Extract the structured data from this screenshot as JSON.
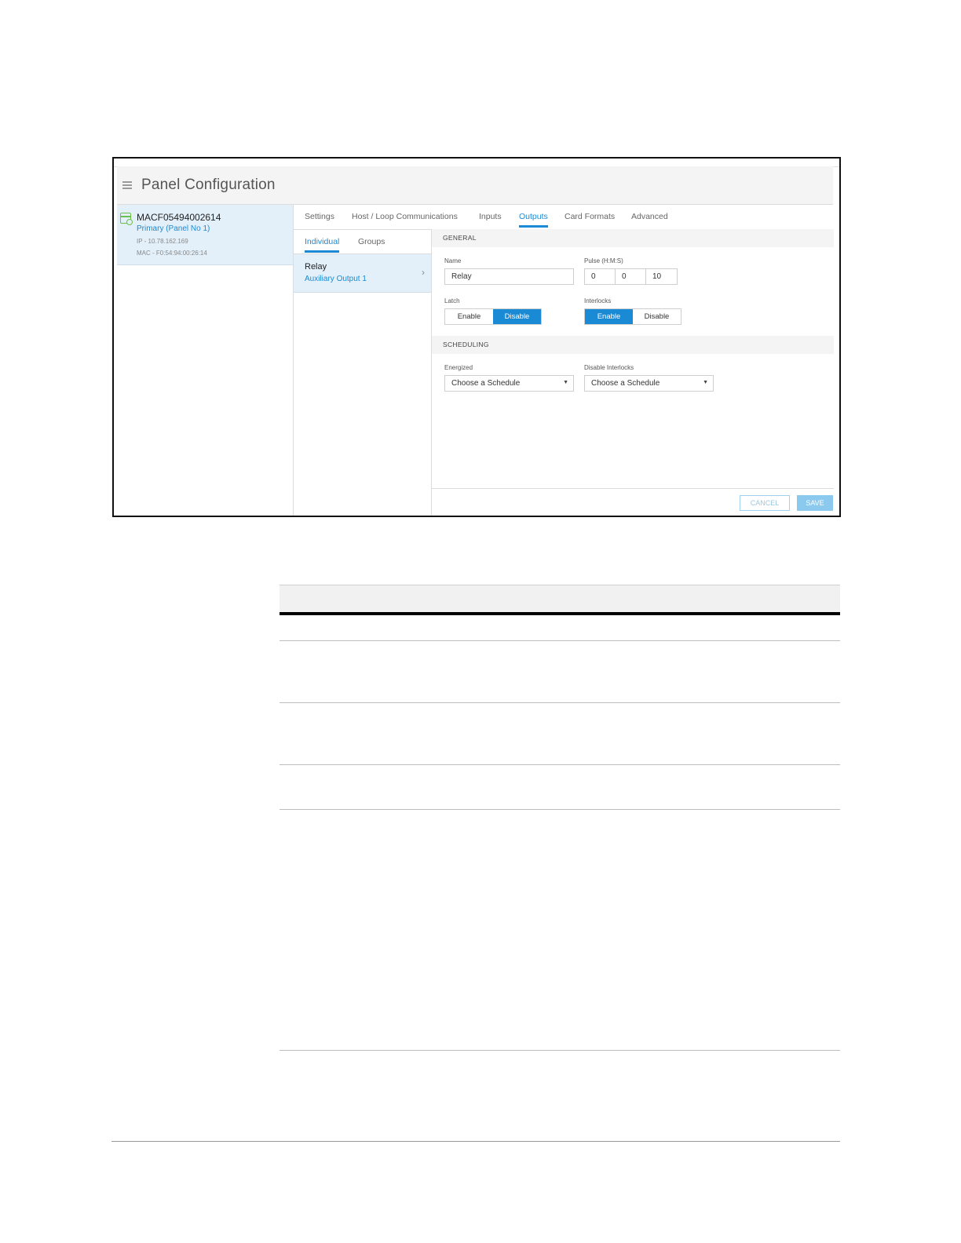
{
  "app": {
    "title": "Panel Configuration"
  },
  "panel": {
    "name": "MACF05494002614",
    "role": "Primary (Panel No 1)",
    "ip": "IP - 10.78.162.169",
    "mac": "MAC - F0:54:94:00:26:14"
  },
  "tabs": [
    {
      "label": "Settings",
      "active": false
    },
    {
      "label": "Host / Loop Communications",
      "active": false
    },
    {
      "label": "Inputs",
      "active": false
    },
    {
      "label": "Outputs",
      "active": true
    },
    {
      "label": "Card Formats",
      "active": false
    },
    {
      "label": "Advanced",
      "active": false
    }
  ],
  "subtabs": [
    {
      "label": "Individual",
      "active": true
    },
    {
      "label": "Groups",
      "active": false
    }
  ],
  "output_item": {
    "name": "Relay",
    "subtitle": "Auxiliary Output 1"
  },
  "general": {
    "title": "GENERAL",
    "name_label": "Name",
    "name_value": "Relay",
    "pulse_label": "Pulse (H:M:S)",
    "pulse_h": "0",
    "pulse_m": "0",
    "pulse_s": "10",
    "latch_label": "Latch",
    "latch_enable": "Enable",
    "latch_disable": "Disable",
    "latch_selected": "Disable",
    "interlocks_label": "Interlocks",
    "interlocks_enable": "Enable",
    "interlocks_disable": "Disable",
    "interlocks_selected": "Enable"
  },
  "scheduling": {
    "title": "SCHEDULING",
    "energized_label": "Energized",
    "energized_value": "Choose a Schedule",
    "disable_interlocks_label": "Disable Interlocks",
    "disable_interlocks_value": "Choose a Schedule"
  },
  "actions": {
    "cancel_label": "CANCEL",
    "save_label": "SAVE"
  },
  "colors": {
    "accent": "#1a8ad4",
    "selected_bg": "#e3f0fa",
    "status_green": "#6cbf4a"
  }
}
